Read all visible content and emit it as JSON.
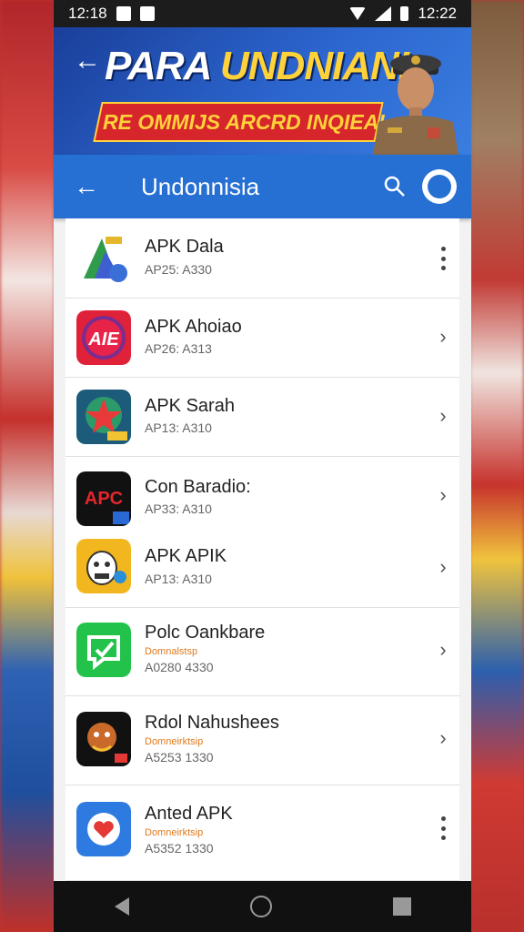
{
  "status_bar": {
    "time_left": "12:18",
    "time_right": "12:22"
  },
  "banner": {
    "back_icon": "arrow-left",
    "title_white": "PARA ",
    "title_yellow": "UNDNIANI",
    "ribbon_text": "RE OMMIJS ARCRD INQIEAI"
  },
  "app_bar": {
    "title": "Undonnisia",
    "back_icon": "arrow-left",
    "search_icon": "magnifier",
    "avatar_icon": "profile"
  },
  "apps": [
    {
      "name": "APK Dala",
      "sub": "AP25: A330",
      "tag": "",
      "action": "more",
      "icon": "triangle-logo"
    },
    {
      "name": "APK Ahoiao",
      "sub": "AP26: A313",
      "tag": "",
      "action": "chevron",
      "icon": "aie-logo"
    },
    {
      "name": "APK Sarah",
      "sub": "AP13: A310",
      "tag": "",
      "action": "chevron",
      "icon": "star-logo"
    },
    {
      "name": "Con Baradio:",
      "sub": "AP33: A310",
      "tag": "",
      "action": "chevron",
      "icon": "apc-logo"
    },
    {
      "name": "APK APIK",
      "sub": "AP13: A310",
      "tag": "",
      "action": "chevron",
      "icon": "face-logo"
    },
    {
      "name": "Polc Oankbare",
      "sub": "A0280 4330",
      "tag": "Domnalstsp",
      "action": "chevron",
      "icon": "chat-logo"
    },
    {
      "name": "Rdol Nahushees",
      "sub": "A5253 1330",
      "tag": "Domneirktsip",
      "action": "chevron",
      "icon": "character-logo"
    },
    {
      "name": "Anted APK",
      "sub": "A5352 1330",
      "tag": "Domneirktsip",
      "action": "more",
      "icon": "heart-logo"
    }
  ]
}
